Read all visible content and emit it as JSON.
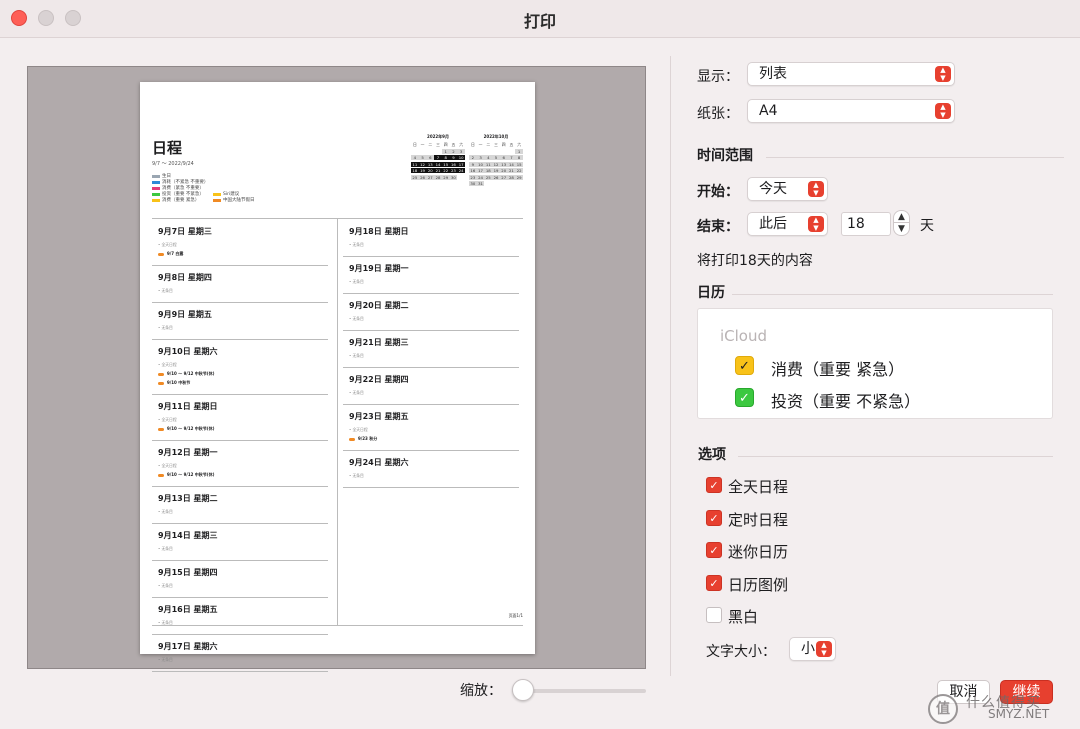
{
  "window": {
    "title": "打印"
  },
  "preview": {
    "title": "日程",
    "range": "9/7 ～ 2022/9/24",
    "legend": [
      {
        "label": "生日",
        "color": "#9aa6b2"
      },
      {
        "label": "消耗（不紧急 不重要）",
        "color": "#2f8bd8"
      },
      {
        "label": "消费（紧急 不重要）",
        "color": "#e23d7a"
      },
      {
        "label": "投资（重要 不紧急）",
        "color": "#3cc840"
      },
      {
        "label": "消费（重要 紧急）",
        "color": "#f8c219"
      },
      {
        "label": "Siri建议",
        "color": "#f8c219"
      },
      {
        "label": "中国大陆节假日",
        "color": "#f08a24"
      }
    ],
    "mini_cal_sep": {
      "title": "2022年9月",
      "head": [
        "日",
        "一",
        "二",
        "三",
        "四",
        "五",
        "六"
      ],
      "cells": [
        "",
        "",
        "",
        "",
        "1",
        "2",
        "3",
        "4",
        "5",
        "6",
        "7",
        "8",
        "9",
        "10",
        "11",
        "12",
        "13",
        "14",
        "15",
        "16",
        "17",
        "18",
        "19",
        "20",
        "21",
        "22",
        "23",
        "24",
        "25",
        "26",
        "27",
        "28",
        "29",
        "30",
        ""
      ]
    },
    "mini_cal_oct": {
      "title": "2022年10月",
      "head": [
        "日",
        "一",
        "二",
        "三",
        "四",
        "五",
        "六"
      ],
      "cells": [
        "",
        "",
        "",
        "",
        "",
        "",
        "1",
        "2",
        "3",
        "4",
        "5",
        "6",
        "7",
        "8",
        "9",
        "10",
        "11",
        "12",
        "13",
        "14",
        "15",
        "16",
        "17",
        "18",
        "19",
        "20",
        "21",
        "22",
        "23",
        "24",
        "25",
        "26",
        "27",
        "28",
        "29",
        "30",
        "31",
        "",
        "",
        "",
        "",
        ""
      ]
    },
    "left_days": [
      {
        "heading": "9月7日 星期三",
        "sub": "• 全天日程",
        "events": [
          "9/7 白露"
        ]
      },
      {
        "heading": "9月8日 星期四",
        "sub": "• 无条目",
        "events": []
      },
      {
        "heading": "9月9日 星期五",
        "sub": "• 无条目",
        "events": []
      },
      {
        "heading": "9月10日 星期六",
        "sub": "• 全天日程",
        "events": [
          "9/10 ～ 9/12 中秋节(休)",
          "9/10 中秋节"
        ]
      },
      {
        "heading": "9月11日 星期日",
        "sub": "• 全天日程",
        "events": [
          "9/10 ～ 9/12 中秋节(休)"
        ]
      },
      {
        "heading": "9月12日 星期一",
        "sub": "• 全天日程",
        "events": [
          "9/10 ～ 9/12 中秋节(休)"
        ]
      },
      {
        "heading": "9月13日 星期二",
        "sub": "• 无条目",
        "events": []
      },
      {
        "heading": "9月14日 星期三",
        "sub": "• 无条目",
        "events": []
      },
      {
        "heading": "9月15日 星期四",
        "sub": "• 无条目",
        "events": []
      },
      {
        "heading": "9月16日 星期五",
        "sub": "• 无条目",
        "events": []
      },
      {
        "heading": "9月17日 星期六",
        "sub": "• 无条目",
        "events": []
      }
    ],
    "right_days": [
      {
        "heading": "9月18日 星期日",
        "sub": "• 无条目",
        "events": []
      },
      {
        "heading": "9月19日 星期一",
        "sub": "• 无条目",
        "events": []
      },
      {
        "heading": "9月20日 星期二",
        "sub": "• 无条目",
        "events": []
      },
      {
        "heading": "9月21日 星期三",
        "sub": "• 无条目",
        "events": []
      },
      {
        "heading": "9月22日 星期四",
        "sub": "• 无条目",
        "events": []
      },
      {
        "heading": "9月23日 星期五",
        "sub": "• 全天日程",
        "events": [
          "9/23 秋分"
        ]
      },
      {
        "heading": "9月24日 星期六",
        "sub": "• 无条目",
        "events": []
      }
    ],
    "page_label": "页面1/1"
  },
  "zoom": {
    "label": "缩放：",
    "level": 0.0
  },
  "settings": {
    "display_label": "显示：",
    "display_value": "列表",
    "paper_label": "纸张：",
    "paper_value": "A4",
    "time_range_title": "时间范围",
    "start_label": "开始：",
    "start_value": "今天",
    "end_label": "结束：",
    "end_value": "此后",
    "end_days": "18",
    "days_unit": "天",
    "summary": "将打印18天的内容",
    "calendar_title": "日历",
    "calendar_group": "iCloud",
    "calendars": [
      {
        "name": "消费（重要 紧急）",
        "checked": true,
        "color": "#f8c219"
      },
      {
        "name": "投资（重要 不紧急）",
        "checked": true,
        "color": "#3cc840"
      }
    ],
    "options_title": "选项",
    "options": [
      {
        "label": "全天日程",
        "checked": true
      },
      {
        "label": "定时日程",
        "checked": true
      },
      {
        "label": "迷你日历",
        "checked": true
      },
      {
        "label": "日历图例",
        "checked": true
      },
      {
        "label": "黑白",
        "checked": false
      }
    ],
    "text_size_label": "文字大小：",
    "text_size_value": "小"
  },
  "buttons": {
    "cancel": "取消",
    "continue": "继续"
  },
  "watermark": {
    "icon": "值",
    "name": "什么值得买",
    "url": "SMYZ.NET"
  },
  "colors": {
    "accent": "#e7402f"
  }
}
